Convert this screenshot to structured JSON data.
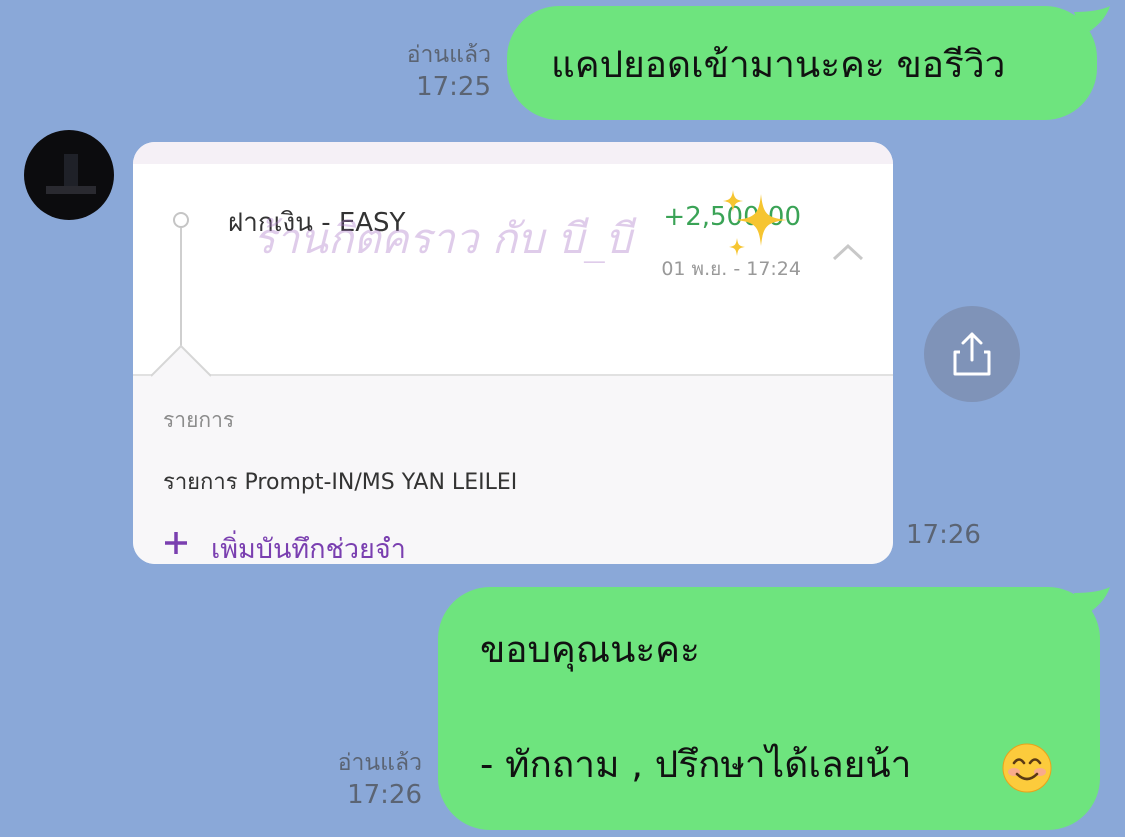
{
  "messages": [
    {
      "direction": "outgoing",
      "text": "แคปยอดเข้ามานะคะ ขอรีวิว",
      "read_label": "อ่านแล้ว",
      "time": "17:25"
    },
    {
      "direction": "incoming",
      "type": "image",
      "time": "17:26",
      "card": {
        "title": "ฝากเงิน - EASY",
        "amount": "+2,500.00",
        "date": "01 พ.ย. - 17:24",
        "watermark": "ร้านกิตคราว กับ บี_บี",
        "detail_label": "รายการ",
        "detail_value": "รายการ Prompt-IN/MS YAN LEILEI",
        "add_note_label": "เพิ่มบันทึกช่วยจำ"
      }
    },
    {
      "direction": "outgoing",
      "line1": "ขอบคุณนะคะ",
      "line2": "- ทักถาม , ปรึกษาได้เลยน้า",
      "emoji": "smiling-face-emoji",
      "read_label": "อ่านแล้ว",
      "time": "17:26"
    }
  ],
  "colors": {
    "background": "#8aa8d8",
    "outgoing_bubble": "#6ee47e",
    "share_button": "#7f93b8",
    "amount_green": "#3aa356",
    "note_purple": "#7a3fb0"
  },
  "icons": {
    "share": "share-icon",
    "avatar": "avatar"
  }
}
